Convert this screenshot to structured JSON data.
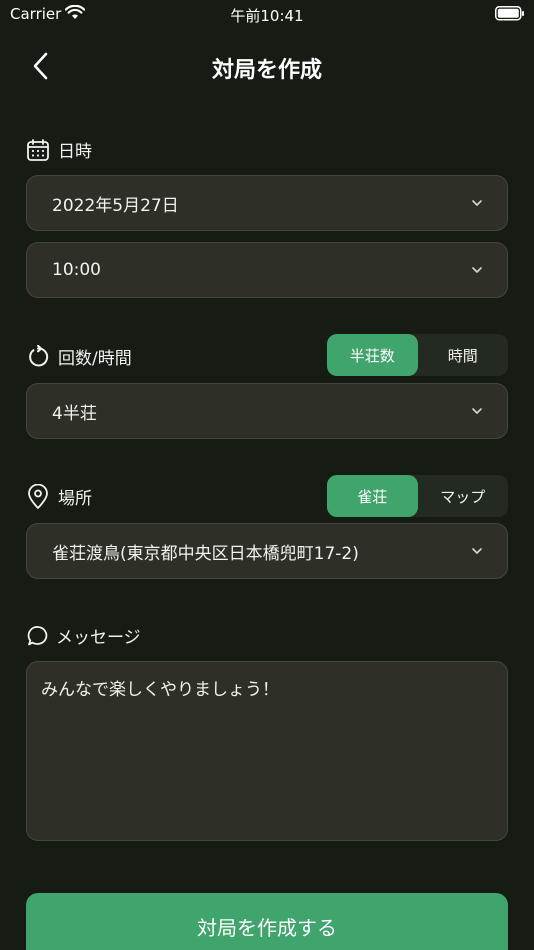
{
  "status_bar": {
    "carrier": "Carrier",
    "time": "午前10:41"
  },
  "nav": {
    "title": "対局を作成"
  },
  "date_time": {
    "label": "日時",
    "date_value": "2022年5月27日",
    "time_value": "10:00"
  },
  "rounds": {
    "label": "回数/時間",
    "segments": [
      "半荘数",
      "時間"
    ],
    "selected_segment": "半荘数",
    "value": "4半荘"
  },
  "place": {
    "label": "場所",
    "segments": [
      "雀荘",
      "マップ"
    ],
    "selected_segment": "雀荘",
    "value": "雀荘渡鳥(東京都中央区日本橋兜町17-2)"
  },
  "message": {
    "label": "メッセージ",
    "value": "みんなで楽しくやりましょう！"
  },
  "submit": {
    "label": "対局を作成する"
  },
  "colors": {
    "background": "#161b13",
    "field": "#2e2f26",
    "accent": "#3fa56c"
  }
}
